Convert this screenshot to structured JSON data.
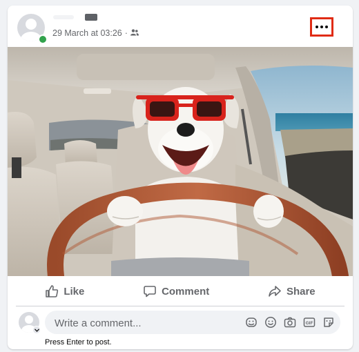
{
  "post": {
    "author_avatar_icon": "user-avatar-icon",
    "timestamp": "29 March at 03:26",
    "separator": "·",
    "audience_icon": "friends-icon",
    "more_icon": "more-options-icon",
    "highlight_color": "#e02b14"
  },
  "photo": {
    "icon": "dog-driving-photo"
  },
  "actions": {
    "like_label": "Like",
    "comment_label": "Comment",
    "share_label": "Share"
  },
  "comment": {
    "placeholder": "Write a comment...",
    "hint": "Press Enter to post.",
    "icons": [
      "sticker-icon",
      "emoji-icon",
      "camera-icon",
      "gif-icon",
      "avatar-sticker-icon"
    ]
  },
  "colors": {
    "secondary_text": "#65676b",
    "online": "#31a24c",
    "input_bg": "#f0f2f5"
  }
}
